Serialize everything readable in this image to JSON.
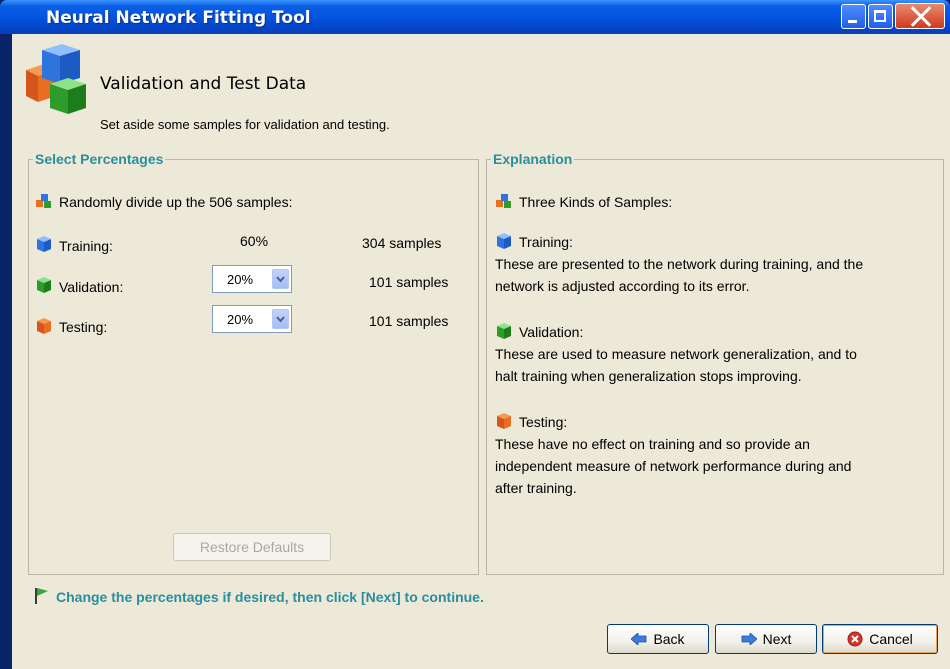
{
  "window": {
    "title": "Neural Network Fitting Tool"
  },
  "header": {
    "title": "Validation and Test Data",
    "subtitle": "Set aside some samples for validation and testing."
  },
  "select_percentages": {
    "legend": "Select Percentages",
    "intro": "Randomly divide up the 506 samples:",
    "rows": [
      {
        "label": "Training:",
        "percent": "60%",
        "samples": "304 samples",
        "color": "#1f6fe0"
      },
      {
        "label": "Validation:",
        "percent": "20%",
        "samples": "101 samples",
        "color": "#2aa52a"
      },
      {
        "label": "Testing:",
        "percent": "20%",
        "samples": "101 samples",
        "color": "#e0651f"
      }
    ],
    "restore_label": "Restore Defaults"
  },
  "explanation": {
    "legend": "Explanation",
    "heading": "Three Kinds of Samples:",
    "training_title": "Training:",
    "training_line1": "These are presented to the network during training, and the",
    "training_line2": "network is adjusted according to its error.",
    "validation_title": "Validation:",
    "validation_line1": "These are used to measure network generalization, and to",
    "validation_line2": "halt training when generalization stops improving.",
    "testing_title": "Testing:",
    "testing_line1": "These have no effect on training and so provide an",
    "testing_line2": "independent measure of network performance during and",
    "testing_line3": "after training."
  },
  "hint": "Change the percentages if desired, then click [Next] to continue.",
  "buttons": {
    "back": "Back",
    "next": "Next",
    "cancel": "Cancel"
  },
  "colors": {
    "accent_teal": "#2a8e9e",
    "titlebar_blue": "#0454e0",
    "panel_bg": "#ece9d8"
  }
}
